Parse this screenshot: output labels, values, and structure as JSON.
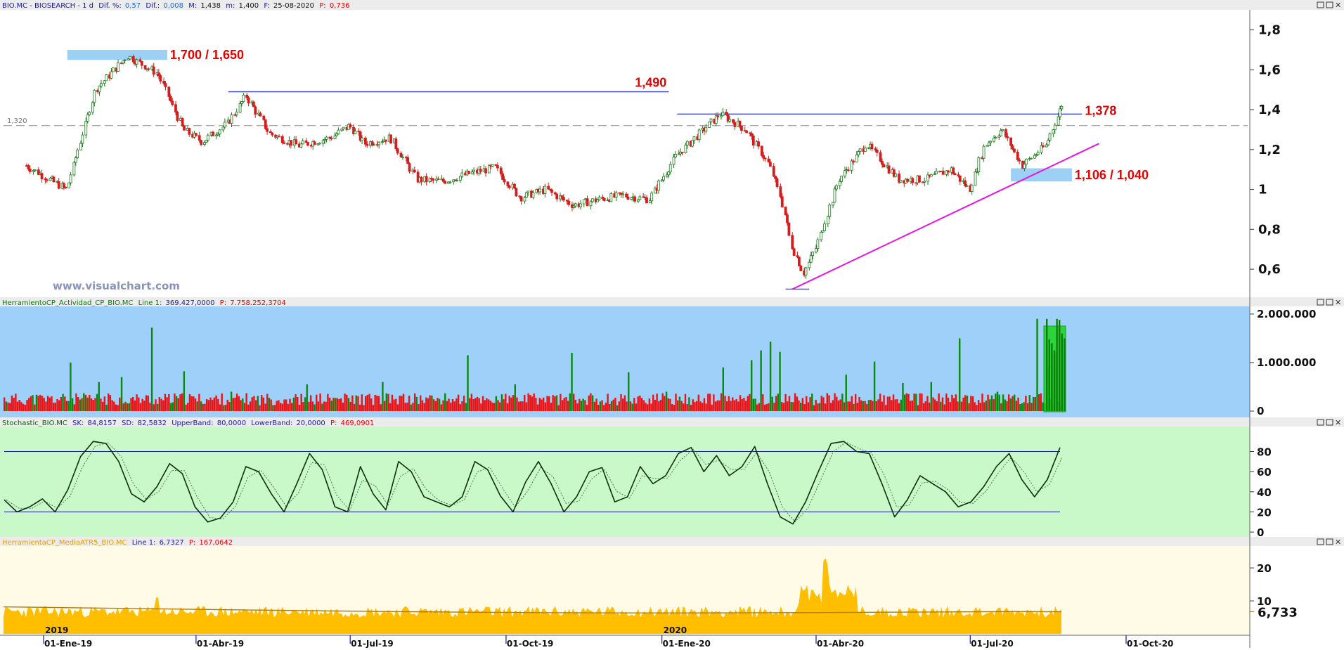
{
  "colors": {
    "accent_red": "#e60000",
    "line_blue": "#3c46dc",
    "trend_magenta": "#e614e6",
    "zone_blue": "#9cd0f5",
    "volume_bg": "#9fd0fa",
    "stoch_bg": "#c9f8c9",
    "atr_bg": "#fffbe6",
    "atr_fill": "#ffbf00",
    "atr_avg": "#b07a10",
    "vol_up": "#0a8a0a",
    "vol_down": "#ee1111",
    "candle_up": "#1c7a1c",
    "candle_down": "#d41e1e"
  },
  "header": {
    "symbol": "BIO.MC - BIOSEARCH - 1 d",
    "dif_pct_label": "Dif. %:",
    "dif_pct_value": "0,57",
    "dif_label": "Dif.:",
    "dif_value": "0,008",
    "max_label": "M:",
    "max_value": "1,438",
    "min_label": "m:",
    "min_value": "1,400",
    "date_label": "F:",
    "date_value": "25-08-2020",
    "price_label": "P:",
    "price_value": "0,736"
  },
  "panels": {
    "volume": {
      "title": "HerramientoCP_Actividad_CP_BIO.MC",
      "line_label": "Line 1:",
      "line_value": "369.427,0000",
      "p_label": "P:",
      "p_value": "7.758.252,3704"
    },
    "stochastic": {
      "title": "Stochastic_BIO.MC",
      "sk_label": "SK:",
      "sk_value": "84,8157",
      "sd_label": "SD:",
      "sd_value": "82,5832",
      "upper_label": "UpperBand:",
      "upper_value": "80,0000",
      "lower_label": "LowerBand:",
      "lower_value": "20,0000",
      "p_label": "P:",
      "p_value": "469,0901"
    },
    "atr": {
      "title": "HerramientaCP_MediaATR5_BIO.MC",
      "line_label": "Line 1:",
      "line_value": "6,7327",
      "p_label": "P:",
      "p_value": "167,0642",
      "last_value": "6,733"
    }
  },
  "watermark": "www.visualchart.com",
  "annotations": {
    "resistance_zone": "1,700 / 1,650",
    "level_1490": "1,490",
    "level_1378": "1,378",
    "support_zone": "1,106 / 1,040",
    "dashed_level": "1,320"
  },
  "axes": {
    "price_ticks": [
      "1,8",
      "1,6",
      "1,4",
      "1,2",
      "1",
      "0,8",
      "0,6"
    ],
    "volume_ticks": [
      "2.000.000",
      "1.000.000",
      "0"
    ],
    "stoch_ticks": [
      "80",
      "60",
      "40",
      "20",
      "0"
    ],
    "atr_ticks": [
      "20",
      "10"
    ],
    "dates": [
      "01-Ene-19",
      "01-Abr-19",
      "01-Jul-19",
      "01-Oct-19",
      "01-Ene-20",
      "01-Abr-20",
      "01-Jul-20",
      "01-Oct-20"
    ],
    "years": [
      "2019",
      "2020"
    ]
  },
  "chart_data": [
    {
      "type": "line",
      "title": "BIO.MC - BIOSEARCH - 1 d",
      "x_range": [
        "2019-01-01",
        "2020-10-15"
      ],
      "ylim": [
        0.47,
        1.89
      ],
      "y_ticks": [
        0.6,
        0.8,
        1.0,
        1.2,
        1.4,
        1.6,
        1.8
      ],
      "series": [
        {
          "name": "BIO.MC",
          "x": [
            "2018-12-20",
            "2019-01-15",
            "2019-02-01",
            "2019-02-20",
            "2019-03-10",
            "2019-03-25",
            "2019-04-05",
            "2019-04-20",
            "2019-05-01",
            "2019-05-15",
            "2019-06-01",
            "2019-06-20",
            "2019-07-01",
            "2019-07-10",
            "2019-07-25",
            "2019-08-10",
            "2019-08-25",
            "2019-09-10",
            "2019-09-25",
            "2019-10-10",
            "2019-10-25",
            "2019-11-10",
            "2019-11-25",
            "2019-12-10",
            "2019-12-25",
            "2020-01-10",
            "2020-01-20",
            "2020-02-05",
            "2020-02-20",
            "2020-03-05",
            "2020-03-12",
            "2020-03-18",
            "2020-03-25",
            "2020-04-01",
            "2020-04-15",
            "2020-05-01",
            "2020-05-20",
            "2020-06-05",
            "2020-06-20",
            "2020-07-01",
            "2020-07-10",
            "2020-07-20",
            "2020-08-01",
            "2020-08-15",
            "2020-08-25"
          ],
          "values": [
            1.13,
            1.0,
            1.5,
            1.67,
            1.58,
            1.3,
            1.24,
            1.33,
            1.47,
            1.28,
            1.22,
            1.26,
            1.32,
            1.23,
            1.26,
            1.05,
            1.04,
            1.08,
            1.11,
            0.96,
            1.0,
            0.92,
            0.95,
            0.97,
            0.95,
            1.17,
            1.25,
            1.38,
            1.3,
            1.12,
            0.95,
            0.72,
            0.58,
            0.7,
            1.05,
            1.23,
            1.05,
            1.05,
            1.1,
            1.0,
            1.22,
            1.3,
            1.12,
            1.22,
            1.43
          ]
        }
      ],
      "levels": [
        {
          "label": "1,700 / 1,650",
          "type": "zone",
          "from": 1.65,
          "to": 1.7
        },
        {
          "label": "1,490",
          "type": "line",
          "value": 1.49
        },
        {
          "label": "1,378",
          "type": "line",
          "value": 1.378
        },
        {
          "label": "1,106 / 1,040",
          "type": "zone",
          "from": 1.04,
          "to": 1.106
        },
        {
          "label": "1,320",
          "type": "dashed",
          "value": 1.32
        }
      ],
      "trendline": {
        "from": {
          "x": "2020-03-18",
          "y": 0.5
        },
        "to": {
          "x": "2020-08-31",
          "y": 1.23
        }
      },
      "grid": false
    },
    {
      "type": "bar",
      "title": "HerramientoCP_Actividad_CP_BIO.MC",
      "ylim": [
        0,
        2100000
      ],
      "y_ticks": [
        0,
        1000000,
        2000000
      ],
      "highlight_values": [
        1900000,
        1480000,
        1400000,
        1250000,
        1900000,
        1880000,
        1600000,
        1500000
      ]
    },
    {
      "type": "line",
      "title": "Stochastic_BIO.MC",
      "ylim": [
        -2,
        102
      ],
      "y_ticks": [
        0,
        20,
        40,
        60,
        80
      ],
      "upper_band": 80,
      "lower_band": 20,
      "series": [
        {
          "name": "SK",
          "values": [
            32,
            20,
            25,
            33,
            20,
            42,
            75,
            90,
            88,
            70,
            38,
            30,
            45,
            68,
            58,
            25,
            10,
            14,
            30,
            65,
            60,
            38,
            20,
            48,
            78,
            62,
            25,
            20,
            65,
            38,
            22,
            70,
            60,
            35,
            30,
            25,
            35,
            70,
            62,
            36,
            20,
            50,
            70,
            48,
            20,
            35,
            60,
            64,
            30,
            35,
            65,
            48,
            56,
            78,
            84,
            60,
            76,
            56,
            65,
            85,
            48,
            15,
            8,
            30,
            60,
            88,
            90,
            80,
            78,
            48,
            15,
            32,
            56,
            48,
            40,
            25,
            30,
            45,
            65,
            78,
            52,
            35,
            52,
            84
          ]
        }
      ]
    },
    {
      "type": "area",
      "title": "HerramientaCP_MediaATR5_BIO.MC",
      "ylim": [
        0,
        26
      ],
      "y_ticks": [
        10,
        20
      ],
      "last_value": 6.733
    }
  ]
}
